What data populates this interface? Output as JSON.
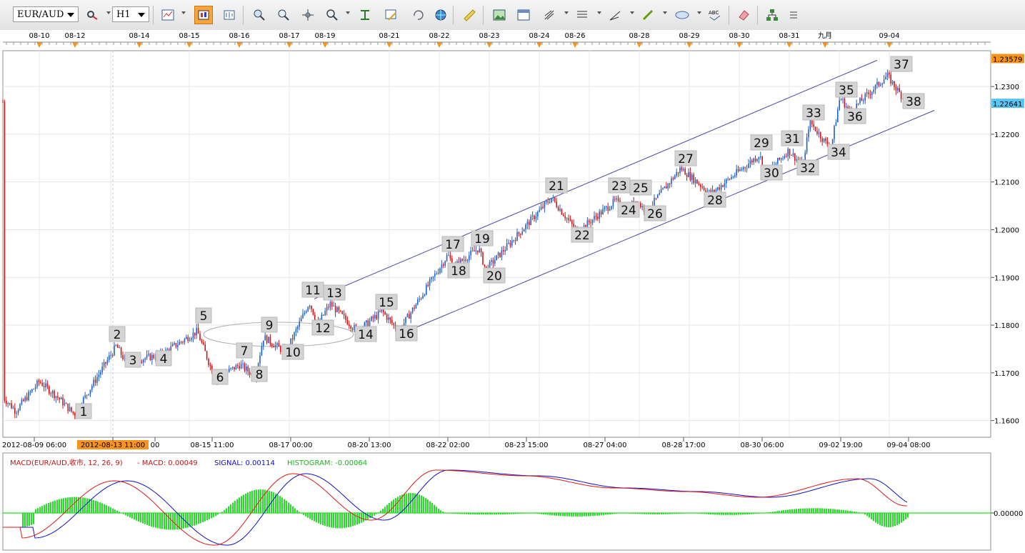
{
  "toolbar": {
    "symbol": "EUR/AUD",
    "timeframe": "H1",
    "icons": [
      "mark-settings-icon",
      "chart-type-icon",
      "candle-chart-icon",
      "bar-chart-icon",
      "zoom-in-icon",
      "zoom-out-icon",
      "crosshair-icon",
      "magnifier-icon",
      "fit-icon",
      "properties-icon",
      "refresh-icon",
      "globe-icon",
      "ruler-icon",
      "image-icon",
      "window-icon",
      "fib-tool-icon",
      "lines-tool-icon",
      "trendline-tool-icon",
      "pencil-tool-icon",
      "ellipse-tool-icon",
      "abc-text-icon",
      "eraser-icon",
      "tree-icon",
      "menu-icon"
    ]
  },
  "top_dates": [
    "08-10",
    "08-12",
    "08-14",
    "08-15",
    "08-16",
    "08-17",
    "08-19",
    "08-21",
    "08-22",
    "08-23",
    "08-24",
    "08-26",
    "08-28",
    "08-29",
    "08-30",
    "08-31",
    "九月",
    "09-04"
  ],
  "bottom_times": [
    "2012-08-09 06:00",
    "2012-08-13 11:00",
    "00",
    "08-15 11:00",
    "08-17 00:00",
    "08-20 13:00",
    "08-22 02:00",
    "08-23 15:00",
    "08-27 04:00",
    "08-28 17:00",
    "08-30 06:00",
    "09-02 19:00",
    "09-04 08:00"
  ],
  "price_axis": {
    "ticks": [
      "1.2300",
      "1.2200",
      "1.2100",
      "1.2000",
      "1.1900",
      "1.1800",
      "1.1700",
      "1.1600"
    ],
    "high_marker": "1.23579",
    "current_marker": "1.22641"
  },
  "macd": {
    "title": "MACD(EUR/AUD,收市, 12, 26, 9)",
    "macd_text": "- MACD: 0.00049",
    "signal_text": "SIGNAL: 0.00114",
    "histogram_text": "HISTOGRAM: -0.00064",
    "zero_label": "0.00000"
  },
  "colors": {
    "up": "#1f5fd0",
    "down": "#d01414",
    "macd_line": "#e01818",
    "signal_line": "#1010c8",
    "histogram": "#22e022",
    "channel": "#4a4aa8",
    "high_marker": "#f7941d",
    "current_marker": "#59c6f2",
    "crosshair_tag": "#f7941d"
  },
  "chart_data": {
    "type": "candlestick",
    "instrument": "EUR/AUD",
    "timeframe": "H1",
    "ylim": [
      1.1565,
      1.2375
    ],
    "wave_points": [
      {
        "label": "1",
        "price": 1.1613
      },
      {
        "label": "2",
        "price": 1.1757
      },
      {
        "label": "3",
        "price": 1.1722
      },
      {
        "label": "4",
        "price": 1.1738
      },
      {
        "label": "5",
        "price": 1.1787
      },
      {
        "label": "6",
        "price": 1.1688
      },
      {
        "label": "7",
        "price": 1.1717
      },
      {
        "label": "8",
        "price": 1.1692
      },
      {
        "label": "9",
        "price": 1.1775
      },
      {
        "label": "10",
        "price": 1.1742
      },
      {
        "label": "11",
        "price": 1.1848
      },
      {
        "label": "12",
        "price": 1.1801
      },
      {
        "label": "13",
        "price": 1.1845
      },
      {
        "label": "14",
        "price": 1.1787
      },
      {
        "label": "15",
        "price": 1.1829
      },
      {
        "label": "16",
        "price": 1.1787
      },
      {
        "label": "17",
        "price": 1.1947
      },
      {
        "label": "18",
        "price": 1.1923
      },
      {
        "label": "19",
        "price": 1.1961
      },
      {
        "label": "20",
        "price": 1.1916
      },
      {
        "label": "21",
        "price": 1.2067
      },
      {
        "label": "22",
        "price": 1.1995
      },
      {
        "label": "23",
        "price": 1.2061
      },
      {
        "label": "24",
        "price": 1.2036
      },
      {
        "label": "25",
        "price": 1.2062
      },
      {
        "label": "26",
        "price": 1.2038
      },
      {
        "label": "27",
        "price": 1.2129
      },
      {
        "label": "28",
        "price": 1.2075
      },
      {
        "label": "29",
        "price": 1.2157
      },
      {
        "label": "30",
        "price": 1.2118
      },
      {
        "label": "31",
        "price": 1.2166
      },
      {
        "label": "32",
        "price": 1.2132
      },
      {
        "label": "33",
        "price": 1.2228
      },
      {
        "label": "34",
        "price": 1.2168
      },
      {
        "label": "35",
        "price": 1.2278
      },
      {
        "label": "36",
        "price": 1.2247
      },
      {
        "label": "37",
        "price": 1.2323
      },
      {
        "label": "38",
        "price": 1.2268
      }
    ]
  }
}
